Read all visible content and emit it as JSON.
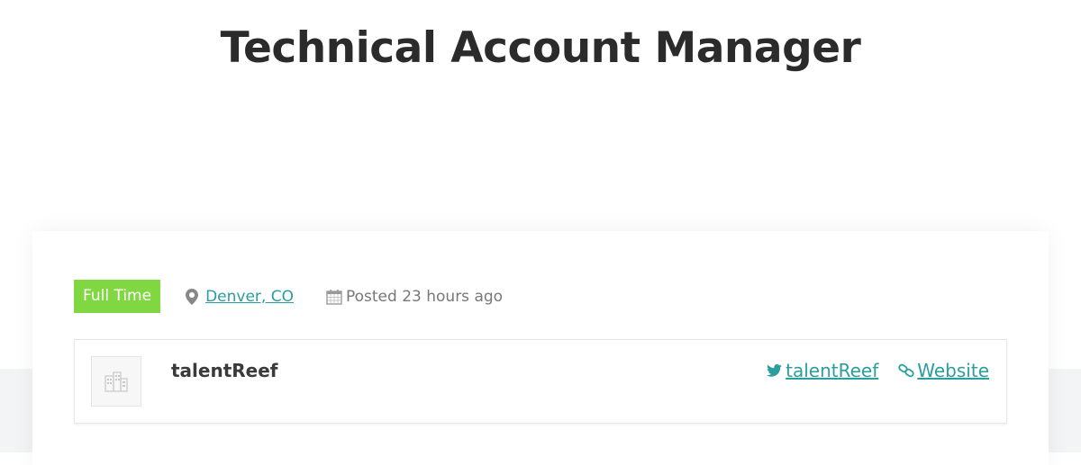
{
  "page": {
    "title": "Technical Account Manager"
  },
  "job": {
    "type": "Full Time",
    "type_color": "#81d742",
    "location": "Denver, CO",
    "posted": "Posted 23 hours ago"
  },
  "company": {
    "name": "talentReef",
    "twitter": "talentReef",
    "website_label": "Website",
    "link_color": "#2a9d9d"
  },
  "icons": {
    "location": "map-pin-icon",
    "posted": "calendar-icon",
    "twitter": "twitter-icon",
    "website": "link-icon",
    "logo": "company-placeholder-icon"
  }
}
